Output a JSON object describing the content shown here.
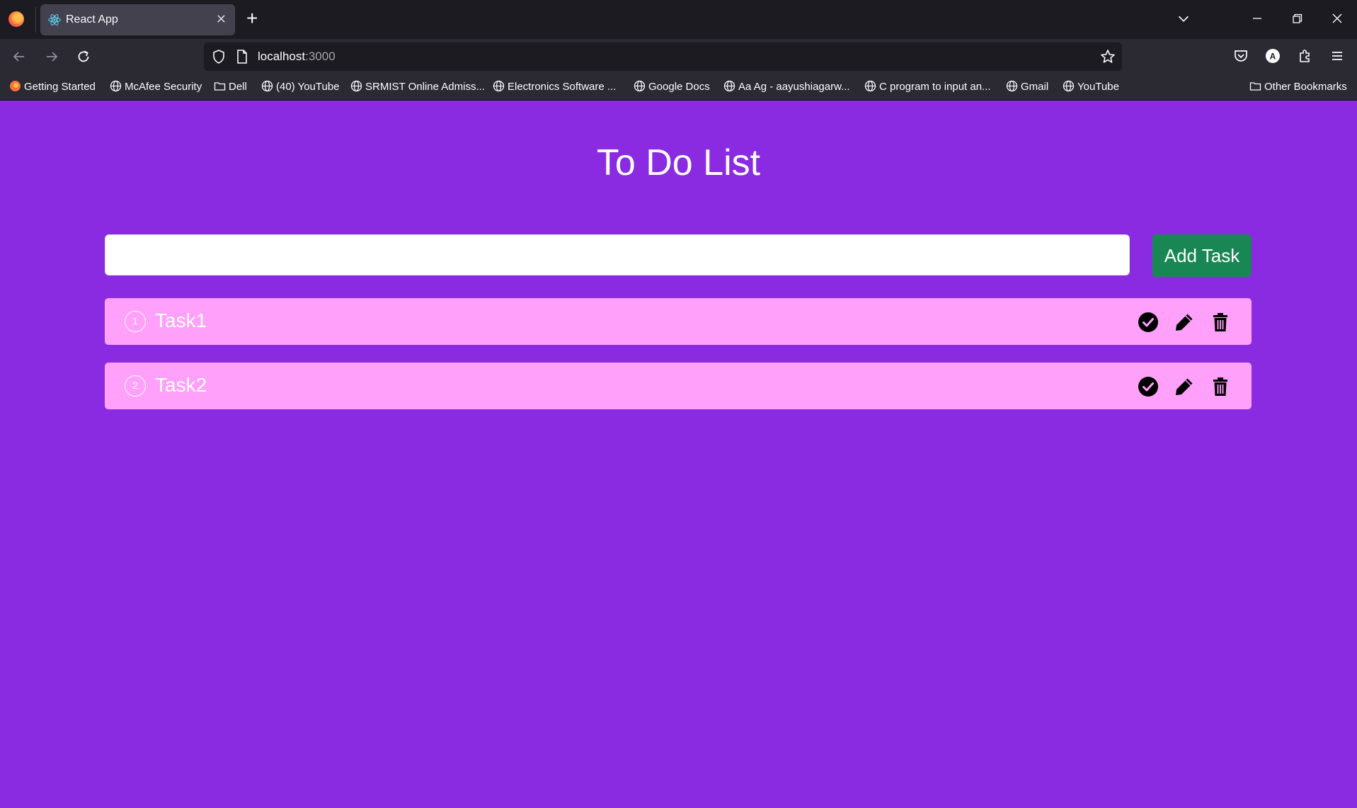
{
  "browser": {
    "tab_title": "React App",
    "url_host": "localhost",
    "url_port": ":3000",
    "profile_initial": "A",
    "bookmarks": [
      {
        "label": "Getting Started",
        "icon": "firefox-icon"
      },
      {
        "label": "McAfee Security",
        "icon": "globe-icon"
      },
      {
        "label": "Dell",
        "icon": "folder-icon"
      },
      {
        "label": "(40) YouTube",
        "icon": "globe-icon"
      },
      {
        "label": "SRMIST Online Admiss...",
        "icon": "globe-icon"
      },
      {
        "label": "Electronics Software ...",
        "icon": "globe-icon"
      },
      {
        "label": "Google Docs",
        "icon": "globe-icon"
      },
      {
        "label": "Aa Ag - aayushiagarw...",
        "icon": "globe-icon"
      },
      {
        "label": "C program to input an...",
        "icon": "globe-icon"
      },
      {
        "label": "Gmail",
        "icon": "globe-icon"
      },
      {
        "label": "YouTube",
        "icon": "globe-icon"
      }
    ],
    "other_bookmarks": "Other Bookmarks"
  },
  "app": {
    "title": "To Do List",
    "input_value": "",
    "add_button": "Add Task",
    "colors": {
      "background": "#8a2be2",
      "task_row": "#ffa1fb",
      "add_button": "#198754"
    },
    "tasks": [
      {
        "number": "1",
        "text": "Task1"
      },
      {
        "number": "2",
        "text": "Task2"
      }
    ]
  }
}
